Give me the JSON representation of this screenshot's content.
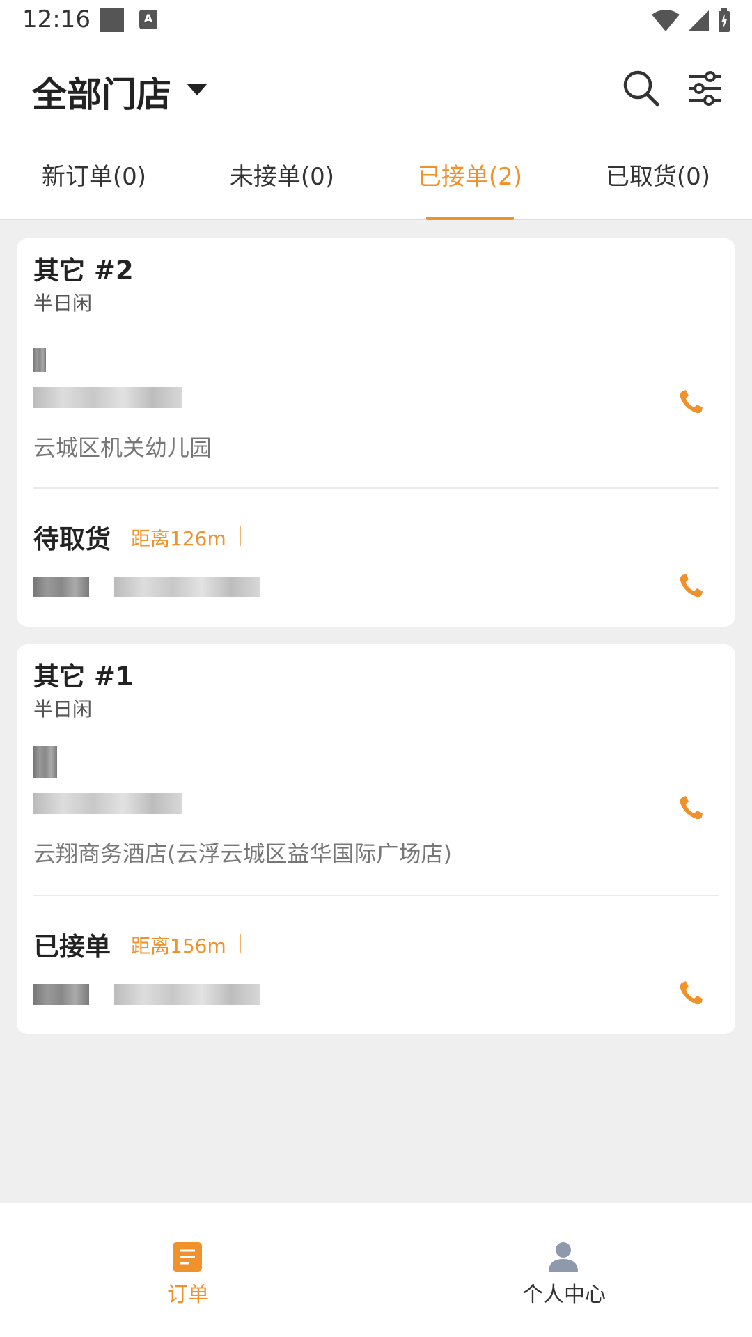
{
  "status_bar": {
    "time": "12:16"
  },
  "header": {
    "store_selector": "全部门店",
    "search_icon": "search-icon",
    "filter_icon": "filter-icon"
  },
  "tabs": [
    {
      "label": "新订单(0)",
      "active": false
    },
    {
      "label": "未接单(0)",
      "active": false
    },
    {
      "label": "已接单(2)",
      "active": true
    },
    {
      "label": "已取货(0)",
      "active": false
    }
  ],
  "orders": [
    {
      "title": "其它  #2",
      "shop": "半日闲",
      "address": "云城区机关幼儿园",
      "status": "待取货",
      "distance": "距离126m"
    },
    {
      "title": "其它  #1",
      "shop": "半日闲",
      "address": "云翔商务酒店(云浮云城区益华国际广场店)",
      "status": "已接单",
      "distance": "距离156m"
    }
  ],
  "bottom_nav": [
    {
      "label": "订单",
      "icon": "orders-icon",
      "active": true
    },
    {
      "label": "个人中心",
      "icon": "profile-icon",
      "active": false
    }
  ],
  "colors": {
    "accent": "#f0922b",
    "background": "#efefef"
  }
}
